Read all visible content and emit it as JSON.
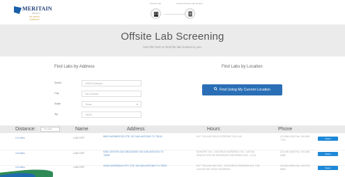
{
  "header": {
    "logo_text": "MERITAIN",
    "logo_sub": "HEALTH",
    "logo_sub2": "AN AETNA COMPANY",
    "steps": [
      {
        "label": "Choose Lab",
        "icon": "building-icon"
      },
      {
        "label": "Choose Partner Lab Locator",
        "icon": "document-icon"
      }
    ]
  },
  "hero": {
    "title": "Offsite Lab Screening",
    "subtitle": "Use this form to find the lab closest to you."
  },
  "find_by_address": {
    "title": "Find Labs by Address",
    "fields": [
      {
        "label": "Street",
        "placeholder": "10000 Example"
      },
      {
        "label": "City",
        "placeholder": "San Antonio"
      },
      {
        "label": "State",
        "value": "Texas"
      },
      {
        "label": "Zip",
        "placeholder": "78023"
      }
    ]
  },
  "find_by_location": {
    "title": "Find Labs by Location",
    "button_label": "Find Using My Current Location"
  },
  "table": {
    "headers": {
      "distance": "Distance:",
      "distance_select": "< 10 miles",
      "name": "Name",
      "address": "Address",
      "hours": "Hours",
      "phone": "Phone"
    },
    "rows": [
      {
        "distance": "0.0 miles",
        "name": "LABCORP",
        "address": "8800 HUEBNER RD STE 102 SAN ANTONIO TX 78240",
        "hours": "M-F 7:00-4:30 DRUG SCREENS 7:00-4:00",
        "phone": "210-696-0118 Fax: 210-696-7723",
        "button": "Select"
      },
      {
        "distance": "4.8 miles",
        "name": "LABCORP",
        "address": "9350 CENTER OAK BROADWAY 200 SAN ANTONIO TX 78258",
        "hours": "MON-FRI 7:00 - 3:30 DRUG SCREENS 7:00 - 3:00 NO DRUGS SCR ON SATURDAYS SATURDAY 8:00 - 11:30",
        "phone": "210-496-5169 Fax: 210-496-6458",
        "button": "Select"
      },
      {
        "distance": "4.8 miles",
        "name": "LABCORP",
        "address": "15449 WURZBACH PKY STE 100 SAN ANTONIO TX 78229",
        "hours": "M-F 7:00-4:30 SAT 8:00 - 12:00 DRUG SCREENS M-F 7:00-4:00 NO SAT DRUG SCREENS",
        "phone": "210-614-5030 Fax: 210-975-5848",
        "button": "Select"
      }
    ]
  },
  "colors": {
    "primary_blue": "#2a6fb5",
    "select_blue": "#1e88d8",
    "link_blue": "#5b8fc9",
    "hero_bg": "#ebebeb"
  }
}
